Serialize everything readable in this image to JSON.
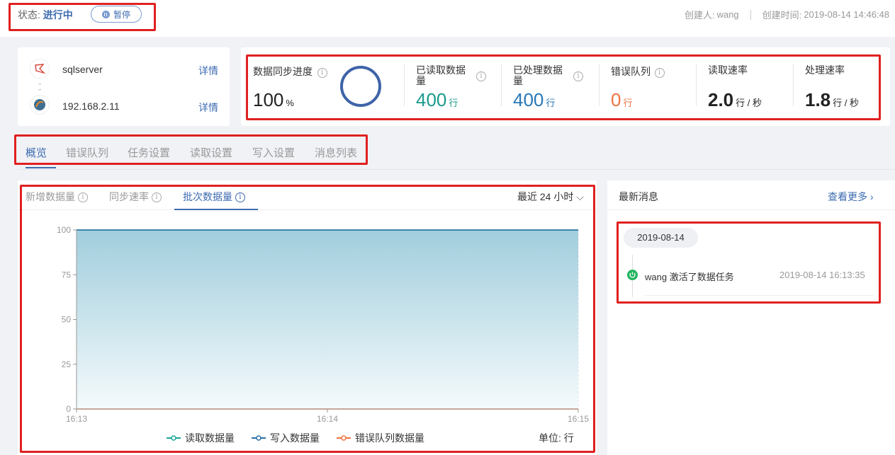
{
  "header": {
    "status_label": "状态:",
    "status_value": "进行中",
    "pause_button": "暂停",
    "creator_label": "创建人:",
    "creator": "wang",
    "created_label": "创建时间:",
    "created_time": "2019-08-14 14:46:48"
  },
  "source": {
    "src_name": "sqlserver",
    "src_detail": "详情",
    "dst_name": "192.168.2.11",
    "dst_detail": "详情"
  },
  "metrics": {
    "progress_label": "数据同步进度",
    "progress_value": "100",
    "progress_unit": "%",
    "progress_fraction": 1.0,
    "read_label": "已读取数据量",
    "read_value": "400",
    "read_unit": "行",
    "processed_label": "已处理数据量",
    "processed_value": "400",
    "processed_unit": "行",
    "error_label": "错误队列",
    "error_value": "0",
    "error_unit": "行",
    "read_rate_label": "读取速率",
    "read_rate_value": "2.0",
    "read_rate_unit": "行 / 秒",
    "process_rate_label": "处理速率",
    "process_rate_value": "1.8",
    "process_rate_unit": "行 / 秒"
  },
  "tabs": [
    "概览",
    "错误队列",
    "任务设置",
    "读取设置",
    "写入设置",
    "消息列表"
  ],
  "chart_panel": {
    "subtabs": [
      "新增数据量",
      "同步速率",
      "批次数据量"
    ],
    "range": "最近 24 小时",
    "unit": "单位: 行"
  },
  "chart_data": {
    "type": "area",
    "x": [
      "16:13",
      "16:14",
      "16:15"
    ],
    "ylim": [
      0,
      100
    ],
    "yticks": [
      0,
      25,
      50,
      75,
      100
    ],
    "series": [
      {
        "name": "读取数据量",
        "color": "#1aa69a",
        "values": [
          100,
          100,
          100
        ]
      },
      {
        "name": "写入数据量",
        "color": "#2a6fa8",
        "values": [
          100,
          100,
          100
        ]
      },
      {
        "name": "错误队列数据量",
        "color": "#f07140",
        "values": [
          0,
          0,
          0
        ]
      }
    ],
    "grid": true,
    "legend": "bottom"
  },
  "messages": {
    "title": "最新消息",
    "more": "查看更多",
    "date": "2019-08-14",
    "items": [
      {
        "text": "wang 激活了数据任务",
        "time": "2019-08-14 16:13:35"
      }
    ]
  },
  "colors": {
    "accent": "#3c6bb0",
    "read": "#1a9a8c",
    "processed": "#2878b8",
    "error": "#f07140",
    "success": "#22b45f"
  }
}
